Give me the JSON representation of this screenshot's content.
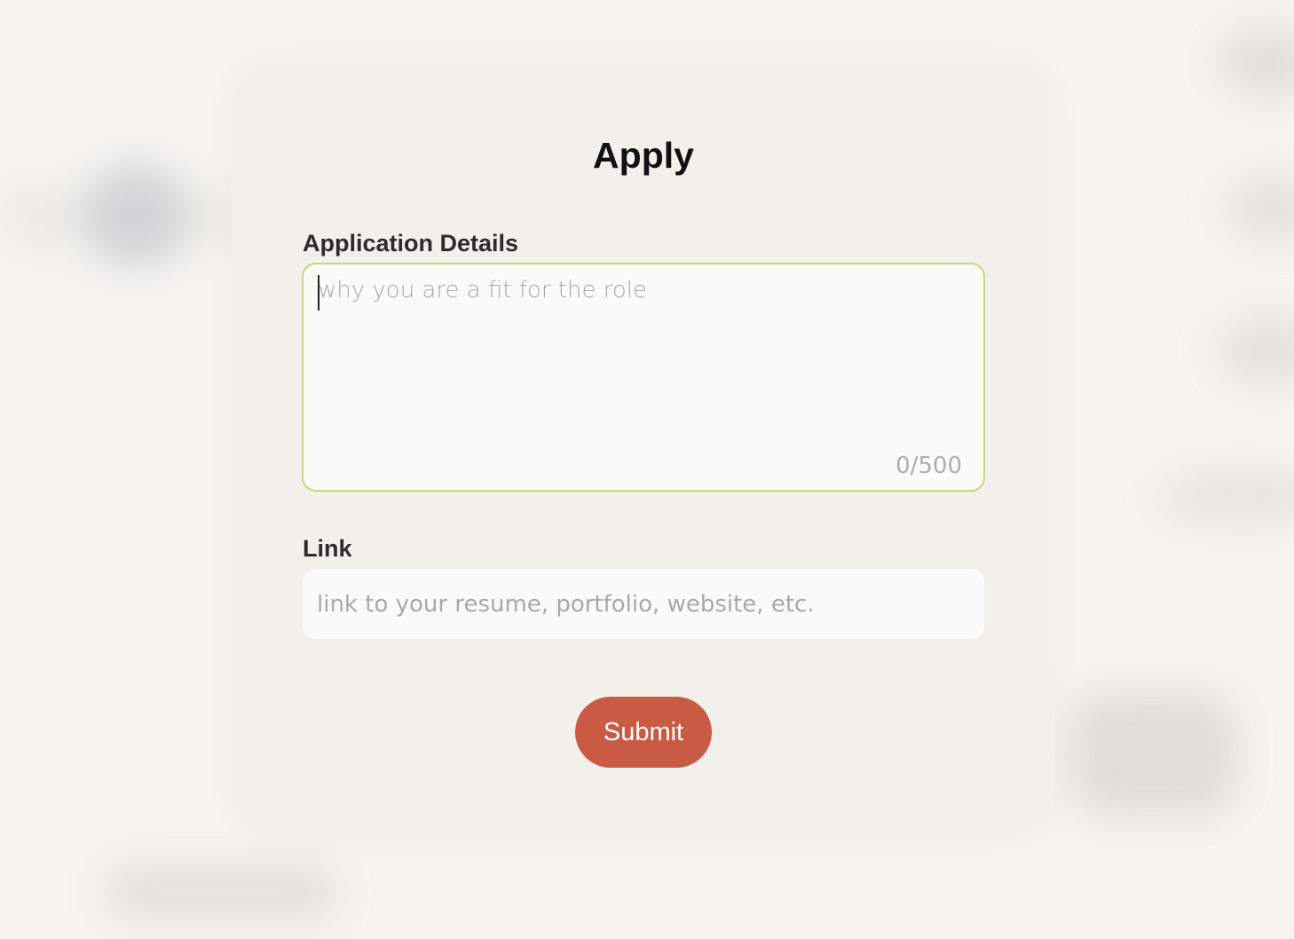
{
  "modal": {
    "title": "Apply",
    "details": {
      "label": "Application Details",
      "placeholder": "why you are a fit for the role",
      "value": "",
      "char_count": "0/500"
    },
    "link": {
      "label": "Link",
      "placeholder": "link to your resume, portfolio, website, etc.",
      "value": ""
    },
    "submit_label": "Submit"
  },
  "colors": {
    "accent": "#c95b45",
    "focus_border": "#c8d77f",
    "modal_bg": "#f1f0eb",
    "page_bg": "#f5f4ef"
  }
}
